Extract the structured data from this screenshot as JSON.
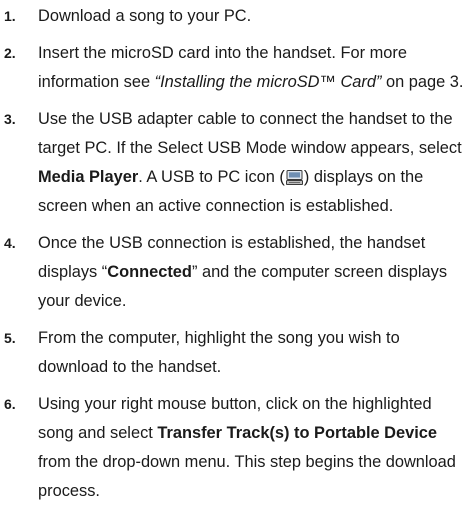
{
  "steps": [
    {
      "number": "1.",
      "text": "Download a song to your PC."
    },
    {
      "number": "2.",
      "text_a": "Insert the microSD card into the handset. For more information see ",
      "link_text": "“Installing the microSD™ Card”",
      "text_b": " on page 3."
    },
    {
      "number": "3.",
      "text_a": "Use the USB adapter cable to connect the handset to the target PC. If the Select USB Mode window appears, select ",
      "bold_text": "Media Player",
      "text_b": ". A USB to PC icon (",
      "icon": "usb-to-pc-icon",
      "text_c": ") displays on the screen when an active connection is established."
    },
    {
      "number": "4.",
      "text_a": "Once the USB connection is established, the handset displays “",
      "bold_text": "Connected",
      "text_b": "” and the computer screen displays your device."
    },
    {
      "number": "5.",
      "text": "From the computer, highlight the song you wish to download to the handset."
    },
    {
      "number": "6.",
      "text_a": "Using your right mouse button, click on the highlighted song and select ",
      "bold_text": "Transfer Track(s) to Portable Device",
      "text_b": " from the drop-down menu. This step begins the download process."
    }
  ]
}
